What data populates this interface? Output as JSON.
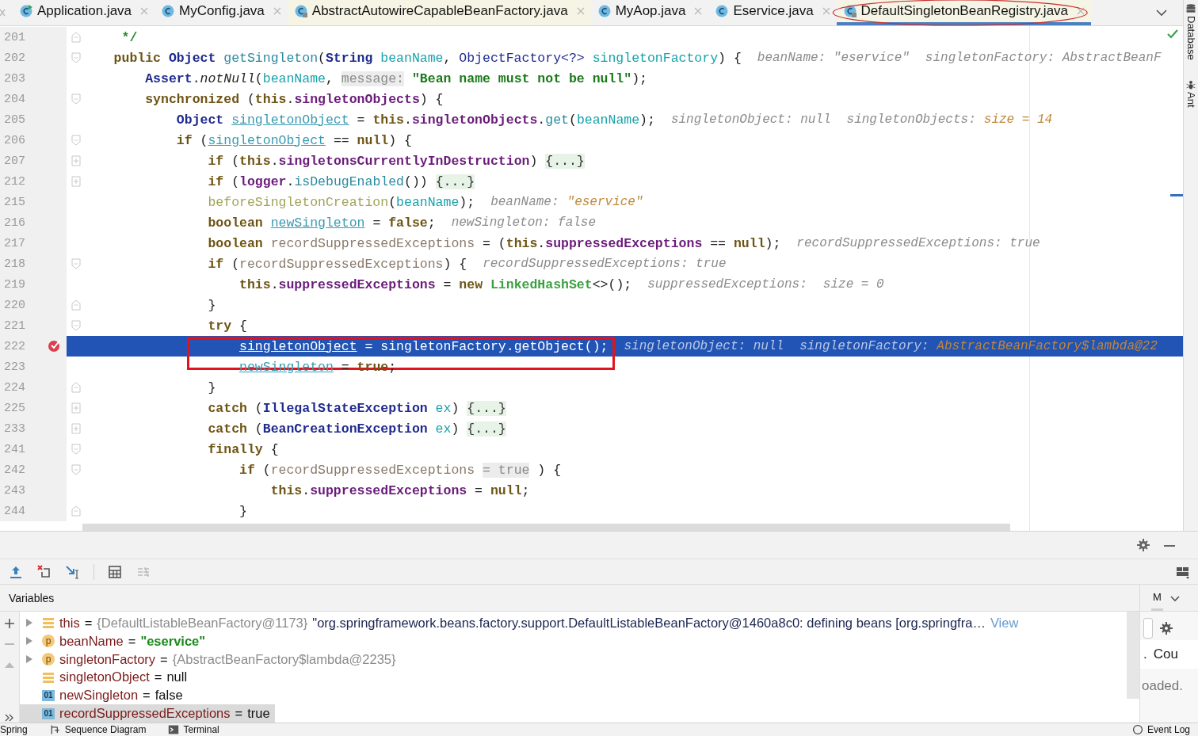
{
  "tabs": [
    {
      "label": "Application.java",
      "kind": "runnable",
      "selected": false,
      "circled": false
    },
    {
      "label": "MyConfig.java",
      "kind": "class",
      "selected": false,
      "circled": false
    },
    {
      "label": "AbstractAutowireCapableBeanFactory.java",
      "kind": "library",
      "selected": false,
      "circled": false
    },
    {
      "label": "MyAop.java",
      "kind": "class",
      "selected": false,
      "circled": false
    },
    {
      "label": "Eservice.java",
      "kind": "class",
      "selected": false,
      "circled": false
    },
    {
      "label": "DefaultSingletonBeanRegistry.java",
      "kind": "library",
      "selected": true,
      "circled": true
    }
  ],
  "editor": {
    "lines": [
      {
        "number": "201",
        "kind": "fold-end",
        "breakpoint": false,
        "current": false,
        "boxed": false,
        "tokens": [
          {
            "text": "     */",
            "kind": "comment"
          }
        ]
      },
      {
        "number": "202",
        "kind": "fold-start",
        "breakpoint": false,
        "current": false,
        "boxed": false,
        "tokens": [
          {
            "text": "    public ",
            "kind": "kw"
          },
          {
            "text": "Object ",
            "kind": "type"
          },
          {
            "text": "getSingleton",
            "kind": "method"
          },
          {
            "text": "(",
            "kind": "plain"
          },
          {
            "text": "String ",
            "kind": "type"
          },
          {
            "text": "beanName",
            "kind": "param"
          },
          {
            "text": ", ",
            "kind": "plain"
          },
          {
            "text": "ObjectFactory<?> ",
            "kind": "typeref"
          },
          {
            "text": "singletonFactory",
            "kind": "param"
          },
          {
            "text": ") {",
            "kind": "plain"
          }
        ],
        "hints": [
          {
            "text": "beanName: \"eservice\"",
            "kind": "label"
          },
          {
            "text": "singletonFactory: AbstractBeanF",
            "kind": "label"
          }
        ]
      },
      {
        "number": "203",
        "kind": "plain",
        "breakpoint": false,
        "current": false,
        "boxed": false,
        "tokens": [
          {
            "text": "        Assert",
            "kind": "type"
          },
          {
            "text": ".",
            "kind": "plain"
          },
          {
            "text": "notNull",
            "kind": "static"
          },
          {
            "text": "(",
            "kind": "plain"
          },
          {
            "text": "beanName",
            "kind": "param"
          },
          {
            "text": ", ",
            "kind": "plain"
          },
          {
            "text": "message:",
            "kind": "inlay"
          },
          {
            "text": " \"Bean name must not be null\"",
            "kind": "string"
          },
          {
            "text": ");",
            "kind": "plain"
          }
        ]
      },
      {
        "number": "204",
        "kind": "fold-start",
        "breakpoint": false,
        "current": false,
        "boxed": false,
        "tokens": [
          {
            "text": "        synchronized",
            "kind": "kw"
          },
          {
            "text": " (",
            "kind": "plain"
          },
          {
            "text": "this",
            "kind": "kw"
          },
          {
            "text": ".",
            "kind": "plain"
          },
          {
            "text": "singletonObjects",
            "kind": "field"
          },
          {
            "text": ") {",
            "kind": "plain"
          }
        ]
      },
      {
        "number": "205",
        "kind": "plain",
        "breakpoint": false,
        "current": false,
        "boxed": false,
        "tokens": [
          {
            "text": "            Object ",
            "kind": "type"
          },
          {
            "text": "singletonObject",
            "kind": "local"
          },
          {
            "text": " = ",
            "kind": "plain"
          },
          {
            "text": "this",
            "kind": "kw"
          },
          {
            "text": ".",
            "kind": "plain"
          },
          {
            "text": "singletonObjects",
            "kind": "field"
          },
          {
            "text": ".",
            "kind": "plain"
          },
          {
            "text": "get",
            "kind": "method"
          },
          {
            "text": "(",
            "kind": "plain"
          },
          {
            "text": "beanName",
            "kind": "param"
          },
          {
            "text": ");",
            "kind": "plain"
          }
        ],
        "hints": [
          {
            "text": "singletonObject: null",
            "kind": "label"
          },
          {
            "text": "singletonObjects:",
            "kind": "label"
          },
          {
            "text": "size = 14",
            "kind": "value"
          }
        ]
      },
      {
        "number": "206",
        "kind": "fold-start",
        "breakpoint": false,
        "current": false,
        "boxed": false,
        "tokens": [
          {
            "text": "            if",
            "kind": "kw"
          },
          {
            "text": " (",
            "kind": "plain"
          },
          {
            "text": "singletonObject",
            "kind": "local"
          },
          {
            "text": " == ",
            "kind": "plain"
          },
          {
            "text": "null",
            "kind": "kw"
          },
          {
            "text": ") {",
            "kind": "plain"
          }
        ]
      },
      {
        "number": "207",
        "kind": "folded",
        "breakpoint": false,
        "current": false,
        "boxed": false,
        "tokens": [
          {
            "text": "                if",
            "kind": "kw"
          },
          {
            "text": " (",
            "kind": "plain"
          },
          {
            "text": "this",
            "kind": "kw"
          },
          {
            "text": ".",
            "kind": "plain"
          },
          {
            "text": "singletonsCurrentlyInDestruction",
            "kind": "field"
          },
          {
            "text": ") ",
            "kind": "plain"
          },
          {
            "text": "{...}",
            "kind": "folded"
          }
        ]
      },
      {
        "number": "212",
        "kind": "folded",
        "breakpoint": false,
        "current": false,
        "boxed": false,
        "tokens": [
          {
            "text": "                if",
            "kind": "kw"
          },
          {
            "text": " (",
            "kind": "plain"
          },
          {
            "text": "logger",
            "kind": "field"
          },
          {
            "text": ".",
            "kind": "plain"
          },
          {
            "text": "isDebugEnabled",
            "kind": "method"
          },
          {
            "text": "()) ",
            "kind": "plain"
          },
          {
            "text": "{...}",
            "kind": "folded"
          }
        ]
      },
      {
        "number": "215",
        "kind": "plain",
        "breakpoint": false,
        "current": false,
        "boxed": false,
        "tokens": [
          {
            "text": "                beforeSingletonCreation",
            "kind": "call"
          },
          {
            "text": "(",
            "kind": "plain"
          },
          {
            "text": "beanName",
            "kind": "param"
          },
          {
            "text": ");",
            "kind": "plain"
          }
        ],
        "hints": [
          {
            "text": "beanName:",
            "kind": "label"
          },
          {
            "text": "\"eservice\"",
            "kind": "value"
          }
        ]
      },
      {
        "number": "216",
        "kind": "plain",
        "breakpoint": false,
        "current": false,
        "boxed": false,
        "tokens": [
          {
            "text": "                boolean ",
            "kind": "kw"
          },
          {
            "text": "newSingleton",
            "kind": "local"
          },
          {
            "text": " = ",
            "kind": "plain"
          },
          {
            "text": "false",
            "kind": "kw"
          },
          {
            "text": ";",
            "kind": "plain"
          }
        ],
        "hints": [
          {
            "text": "newSingleton: false",
            "kind": "label"
          }
        ]
      },
      {
        "number": "217",
        "kind": "plain",
        "breakpoint": false,
        "current": false,
        "boxed": false,
        "tokens": [
          {
            "text": "                boolean ",
            "kind": "kw"
          },
          {
            "text": "recordSuppressedExceptions",
            "kind": "unused"
          },
          {
            "text": " = (",
            "kind": "plain"
          },
          {
            "text": "this",
            "kind": "kw"
          },
          {
            "text": ".",
            "kind": "plain"
          },
          {
            "text": "suppressedExceptions",
            "kind": "field"
          },
          {
            "text": " == ",
            "kind": "plain"
          },
          {
            "text": "null",
            "kind": "kw"
          },
          {
            "text": ");",
            "kind": "plain"
          }
        ],
        "hints": [
          {
            "text": "recordSuppressedExceptions: true",
            "kind": "label"
          }
        ]
      },
      {
        "number": "218",
        "kind": "fold-start",
        "breakpoint": false,
        "current": false,
        "boxed": false,
        "tokens": [
          {
            "text": "                if",
            "kind": "kw"
          },
          {
            "text": " (",
            "kind": "plain"
          },
          {
            "text": "recordSuppressedExceptions",
            "kind": "unused"
          },
          {
            "text": ") {",
            "kind": "plain"
          }
        ],
        "hints": [
          {
            "text": "recordSuppressedExceptions: true",
            "kind": "label"
          }
        ]
      },
      {
        "number": "219",
        "kind": "plain",
        "breakpoint": false,
        "current": false,
        "boxed": false,
        "tokens": [
          {
            "text": "                    this",
            "kind": "kw"
          },
          {
            "text": ".",
            "kind": "plain"
          },
          {
            "text": "suppressedExceptions",
            "kind": "field"
          },
          {
            "text": " = ",
            "kind": "plain"
          },
          {
            "text": "new ",
            "kind": "kw"
          },
          {
            "text": "LinkedHashSet",
            "kind": "newtype"
          },
          {
            "text": "<>();",
            "kind": "plain"
          }
        ],
        "hints": [
          {
            "text": "suppressedExceptions:",
            "kind": "label"
          },
          {
            "text": "size = 0",
            "kind": "label"
          }
        ]
      },
      {
        "number": "220",
        "kind": "fold-end",
        "breakpoint": false,
        "current": false,
        "boxed": false,
        "tokens": [
          {
            "text": "                }",
            "kind": "plain"
          }
        ]
      },
      {
        "number": "221",
        "kind": "fold-start",
        "breakpoint": false,
        "current": false,
        "boxed": false,
        "tokens": [
          {
            "text": "                try",
            "kind": "kw"
          },
          {
            "text": " {",
            "kind": "plain"
          }
        ]
      },
      {
        "number": "222",
        "kind": "plain",
        "breakpoint": true,
        "current": true,
        "boxed": true,
        "tokens": [
          {
            "text": "                    singletonObject",
            "kind": "local"
          },
          {
            "text": " = ",
            "kind": "plain"
          },
          {
            "text": "singletonFactory",
            "kind": "param"
          },
          {
            "text": ".",
            "kind": "plain"
          },
          {
            "text": "getObject",
            "kind": "method"
          },
          {
            "text": "();",
            "kind": "plain"
          }
        ],
        "hints": [
          {
            "text": "singletonObject: null",
            "kind": "label"
          },
          {
            "text": "singletonFactory:",
            "kind": "label"
          },
          {
            "text": "AbstractBeanFactory$lambda@22",
            "kind": "value"
          }
        ]
      },
      {
        "number": "223",
        "kind": "plain",
        "breakpoint": false,
        "current": false,
        "boxed": false,
        "tokens": [
          {
            "text": "                    newSingleton",
            "kind": "local"
          },
          {
            "text": " = ",
            "kind": "plain"
          },
          {
            "text": "true",
            "kind": "kw"
          },
          {
            "text": ";",
            "kind": "plain"
          }
        ]
      },
      {
        "number": "224",
        "kind": "fold-end",
        "breakpoint": false,
        "current": false,
        "boxed": false,
        "tokens": [
          {
            "text": "                }",
            "kind": "plain"
          }
        ]
      },
      {
        "number": "225",
        "kind": "folded",
        "breakpoint": false,
        "current": false,
        "boxed": false,
        "tokens": [
          {
            "text": "                catch",
            "kind": "kw"
          },
          {
            "text": " (",
            "kind": "plain"
          },
          {
            "text": "IllegalStateException ",
            "kind": "type"
          },
          {
            "text": "ex",
            "kind": "param"
          },
          {
            "text": ") ",
            "kind": "plain"
          },
          {
            "text": "{...}",
            "kind": "folded"
          }
        ]
      },
      {
        "number": "233",
        "kind": "folded",
        "breakpoint": false,
        "current": false,
        "boxed": false,
        "tokens": [
          {
            "text": "                catch",
            "kind": "kw"
          },
          {
            "text": " (",
            "kind": "plain"
          },
          {
            "text": "BeanCreationException ",
            "kind": "type"
          },
          {
            "text": "ex",
            "kind": "param"
          },
          {
            "text": ") ",
            "kind": "plain"
          },
          {
            "text": "{...}",
            "kind": "folded"
          }
        ]
      },
      {
        "number": "241",
        "kind": "fold-start",
        "breakpoint": false,
        "current": false,
        "boxed": false,
        "tokens": [
          {
            "text": "                finally",
            "kind": "kw"
          },
          {
            "text": " {",
            "kind": "plain"
          }
        ]
      },
      {
        "number": "242",
        "kind": "fold-start",
        "breakpoint": false,
        "current": false,
        "boxed": false,
        "tokens": [
          {
            "text": "                    if",
            "kind": "kw"
          },
          {
            "text": " (",
            "kind": "plain"
          },
          {
            "text": "recordSuppressedExceptions",
            "kind": "unused"
          },
          {
            "text": " = true",
            "kind": "inlay"
          },
          {
            "text": " ) {",
            "kind": "plain"
          }
        ]
      },
      {
        "number": "243",
        "kind": "plain",
        "breakpoint": false,
        "current": false,
        "boxed": false,
        "tokens": [
          {
            "text": "                        this",
            "kind": "kw"
          },
          {
            "text": ".",
            "kind": "plain"
          },
          {
            "text": "suppressedExceptions",
            "kind": "field"
          },
          {
            "text": " = ",
            "kind": "plain"
          },
          {
            "text": "null",
            "kind": "kw"
          },
          {
            "text": ";",
            "kind": "plain"
          }
        ]
      },
      {
        "number": "244",
        "kind": "fold-end",
        "breakpoint": false,
        "current": false,
        "boxed": false,
        "tokens": [
          {
            "text": "                    }",
            "kind": "plain"
          }
        ]
      }
    ]
  },
  "right_strip": [
    {
      "label": "Database",
      "kind": "database"
    },
    {
      "label": "Ant",
      "kind": "ant"
    }
  ],
  "debugger": {
    "toolbar": [
      {
        "kind": "step-out",
        "disabled": false
      },
      {
        "kind": "drop-frame",
        "disabled": false
      },
      {
        "kind": "run-to-cursor",
        "disabled": false
      },
      {
        "kind": "evaluate",
        "disabled": false
      },
      {
        "kind": "trace",
        "disabled": true
      }
    ],
    "variables_title": "Variables",
    "variables": [
      {
        "name": "this",
        "kind": "field",
        "expandable": true,
        "selected": false,
        "equals": "=",
        "value": {
          "text": "{DefaultListableBeanFactory@1173}",
          "kind": "ref"
        },
        "description": "\"org.springframework.beans.factory.support.DefaultListableBeanFactory@1460a8c0: defining beans [org.springfra…",
        "link": "View"
      },
      {
        "name": "beanName",
        "kind": "param",
        "badge": "p",
        "expandable": true,
        "selected": false,
        "equals": "=",
        "value": {
          "text": "\"eservice\"",
          "kind": "string"
        }
      },
      {
        "name": "singletonFactory",
        "kind": "param",
        "badge": "p",
        "expandable": true,
        "selected": false,
        "equals": "=",
        "value": {
          "text": "{AbstractBeanFactory$lambda@2235}",
          "kind": "ref"
        }
      },
      {
        "name": "singletonObject",
        "kind": "field",
        "expandable": false,
        "selected": false,
        "equals": "=",
        "value": {
          "text": "null",
          "kind": "plain"
        }
      },
      {
        "name": "newSingleton",
        "kind": "primitive",
        "badge": "01",
        "expandable": false,
        "selected": false,
        "equals": "=",
        "value": {
          "text": "false",
          "kind": "plain"
        }
      },
      {
        "name": "recordSuppressedExceptions",
        "kind": "primitive",
        "badge": "01",
        "expandable": false,
        "selected": true,
        "equals": "=",
        "value": {
          "text": "true",
          "kind": "plain"
        }
      }
    ],
    "side_panel": {
      "header": "M",
      "prefix": ".",
      "label": "Cou",
      "status": "oaded."
    }
  },
  "status_bar": {
    "left": [
      {
        "label": "Spring",
        "kind": "none"
      },
      {
        "label": "Sequence Diagram",
        "kind": "diagram"
      },
      {
        "label": "Terminal",
        "kind": "terminal"
      }
    ],
    "right": {
      "label": "Event Log",
      "kind": "log"
    }
  }
}
